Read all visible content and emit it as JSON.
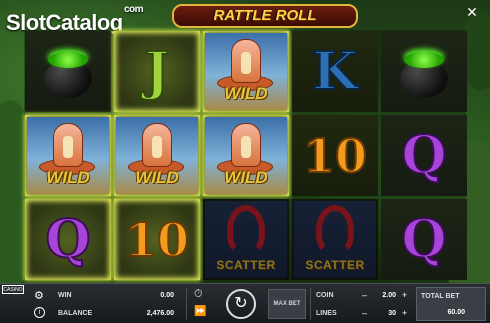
{
  "brand": {
    "site_logo": "SlotCatalog",
    "site_logo_suffix": "com",
    "game_logo": "RATTLE ROLL",
    "casino_tag": "CASINO"
  },
  "icons": {
    "close": "close-icon",
    "settings": "gear-icon",
    "info": "info-icon",
    "stopwatch": "stopwatch-icon",
    "autoplay": "fast-forward-icon",
    "spin": "spin-arrow-icon"
  },
  "reels": [
    [
      "cauldron",
      "WILD",
      "Q"
    ],
    [
      "J",
      "WILD",
      "10"
    ],
    [
      "WILD",
      "WILD",
      "SCATTER"
    ],
    [
      "K",
      "10",
      "SCATTER"
    ],
    [
      "cauldron",
      "Q",
      "Q"
    ]
  ],
  "symbols": {
    "j": "J",
    "q": "Q",
    "k": "K",
    "ten": "10",
    "wild": "WILD",
    "scatter": "SCATTER"
  },
  "controls": {
    "win_label": "WIN",
    "win_value": "0.00",
    "balance_label": "BALANCE",
    "balance_value": "2,476.00",
    "maxbet_label": "MAX BET",
    "coin_label": "COIN",
    "coin_value": "2.00",
    "lines_label": "LINES",
    "lines_value": "30",
    "totalbet_label": "TOTAL BET",
    "totalbet_value": "60.00",
    "minus": "–",
    "plus": "+"
  },
  "colors": {
    "win_glow": "#e6f05a",
    "letter_q": "#a845d8",
    "letter_j": "#9fd33b",
    "letter_k": "#2c6fb4",
    "letter_ten": "#f29b1f"
  }
}
